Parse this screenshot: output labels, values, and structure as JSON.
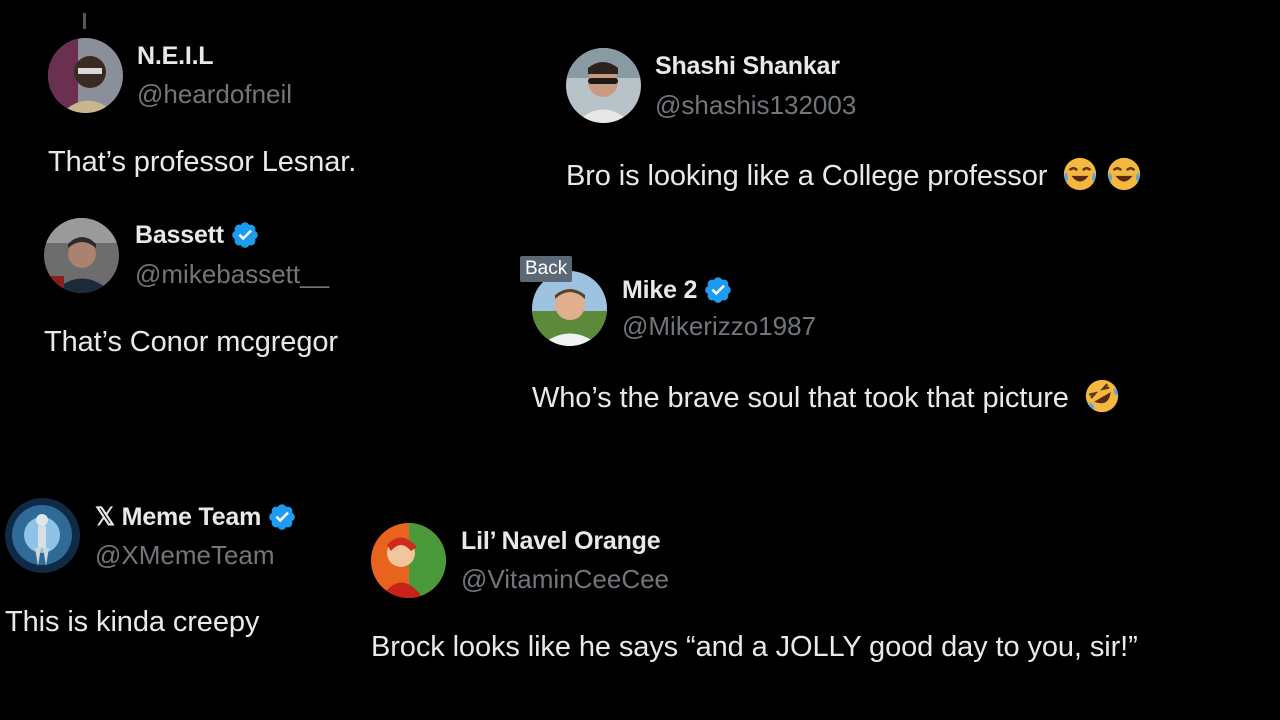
{
  "tweets": {
    "neil": {
      "name": "N.E.I.L",
      "handle": "@heardofneil",
      "text": "That’s professor Lesnar.",
      "avatar_icon": "avatar-neil"
    },
    "shashi": {
      "name": "Shashi Shankar",
      "handle": "@shashis132003",
      "text": "Bro is looking like a College professor",
      "emojis": [
        "face-with-tears-of-joy",
        "face-with-tears-of-joy"
      ],
      "avatar_icon": "avatar-shashi"
    },
    "bassett": {
      "name": "Bassett",
      "handle": "@mikebassett__",
      "text": "That’s Conor mcgregor",
      "verified": true,
      "avatar_icon": "avatar-bassett"
    },
    "mike": {
      "name": "Mike 2",
      "handle": "@Mikerizzo1987",
      "text": "Who’s the brave soul that took that picture",
      "emojis": [
        "rolling-on-the-floor-laughing"
      ],
      "verified": true,
      "avatar_icon": "avatar-mike"
    },
    "xmeme": {
      "name": "𝕏 Meme Team",
      "handle": "@XMemeTeam",
      "text": "This is kinda creepy",
      "verified": true,
      "avatar_icon": "avatar-xmeme"
    },
    "lil": {
      "name": "Lil’ Navel Orange",
      "handle": "@VitaminCeeCee",
      "text": "Brock looks like he says “and a JOLLY good day to you, sir!”",
      "avatar_icon": "avatar-lil"
    }
  },
  "tooltip": {
    "back_label": "Back"
  },
  "colors": {
    "background": "#000000",
    "name": "#e7e9ea",
    "handle": "#71767b",
    "verified": "#1d9bf0",
    "tooltip_bg": "#5b6875"
  }
}
